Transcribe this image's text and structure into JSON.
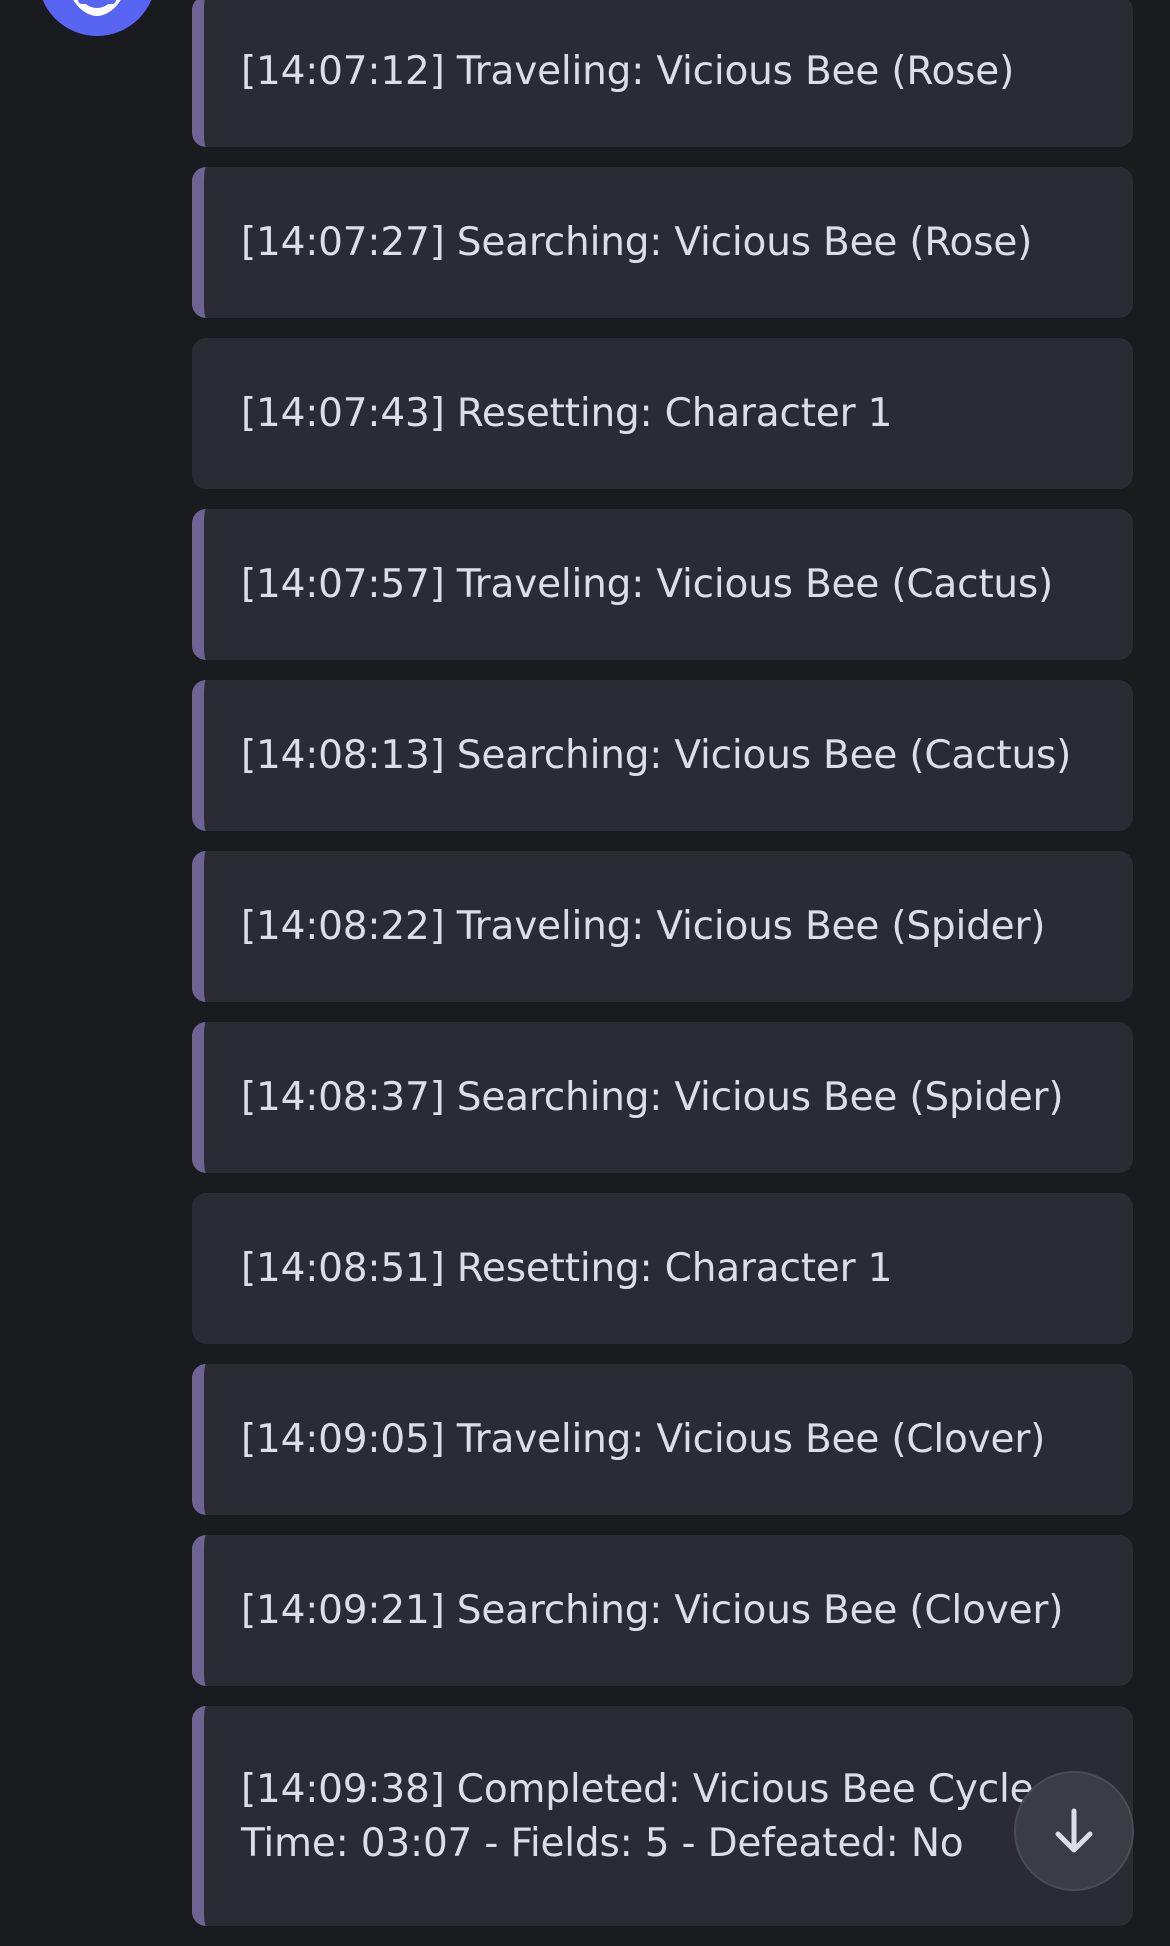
{
  "messages": [
    {
      "text": "[14:07:12] Traveling: Vicious Bee (Rose)",
      "accent": true
    },
    {
      "text": "[14:07:27] Searching: Vicious Bee (Rose)",
      "accent": true
    },
    {
      "text": "[14:07:43] Resetting: Character 1",
      "accent": false
    },
    {
      "text": "[14:07:57] Traveling: Vicious Bee (Cactus)",
      "accent": true
    },
    {
      "text": "[14:08:13] Searching: Vicious Bee (Cactus)",
      "accent": true
    },
    {
      "text": "[14:08:22] Traveling: Vicious Bee (Spider)",
      "accent": true
    },
    {
      "text": "[14:08:37] Searching: Vicious Bee (Spider)",
      "accent": true
    },
    {
      "text": "[14:08:51] Resetting: Character 1",
      "accent": false
    },
    {
      "text": "[14:09:05] Traveling: Vicious Bee (Clover)",
      "accent": true
    },
    {
      "text": "[14:09:21] Searching: Vicious Bee (Clover)",
      "accent": true
    },
    {
      "text": "[14:09:38] Completed: Vicious Bee Cycle\nTime: 03:07 - Fields: 5 - Defeated: No",
      "accent": true
    }
  ],
  "colors": {
    "background": "#1a1b1f",
    "embed_background": "#2b2c33",
    "embed_accent": "#6e6494",
    "avatar": "#5865f2",
    "text": "#dbdee4"
  },
  "icons": {
    "avatar": "discord-logo-icon",
    "scroll": "arrow-down-icon"
  }
}
